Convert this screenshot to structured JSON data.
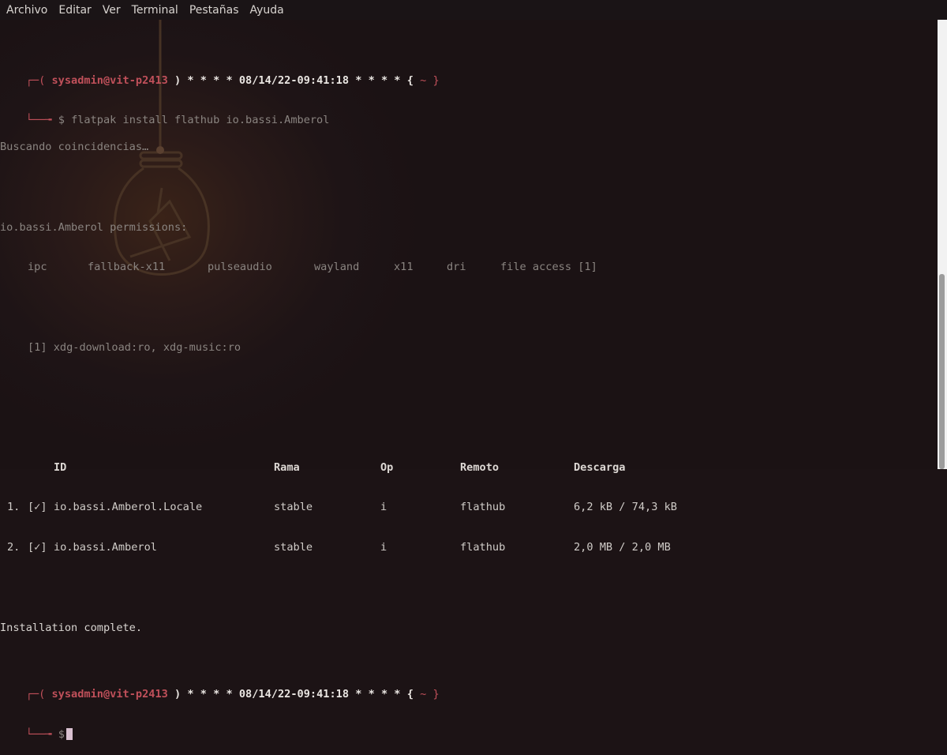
{
  "menu": [
    "Archivo",
    "Editar",
    "Ver",
    "Terminal",
    "Pestañas",
    "Ayuda"
  ],
  "prompt": {
    "open": "┌─(",
    "user": "sysadmin@vit-p2413",
    "close": ")",
    "stars_left": "* * * *",
    "datetime": "08/14/22-09:41:18",
    "stars_right": "* * * *",
    "dir_open": "{",
    "dir": "~",
    "dir_close": "}",
    "second_prefix": "└──╼",
    "dollar": "$"
  },
  "command": "flatpak install flathub io.bassi.Amberol",
  "searching": "Buscando coincidencias…",
  "permissions_title": "io.bassi.Amberol permissions:",
  "permissions": [
    "ipc",
    "fallback-x11",
    "pulseaudio",
    "wayland",
    "x11",
    "dri",
    "file access [1]"
  ],
  "file_access_note": "[1] xdg-download:ro, xdg-music:ro",
  "table": {
    "headers": [
      "ID",
      "Rama",
      "Op",
      "Remoto",
      "Descarga"
    ],
    "rows": [
      {
        "num": "1.",
        "check": "[✓]",
        "id": "io.bassi.Amberol.Locale",
        "rama": "stable",
        "op": "i",
        "remoto": "flathub",
        "descarga": "6,2 kB / 74,3 kB"
      },
      {
        "num": "2.",
        "check": "[✓]",
        "id": "io.bassi.Amberol",
        "rama": "stable",
        "op": "i",
        "remoto": "flathub",
        "descarga": "2,0 MB / 2,0 MB"
      }
    ]
  },
  "complete": "Installation complete."
}
